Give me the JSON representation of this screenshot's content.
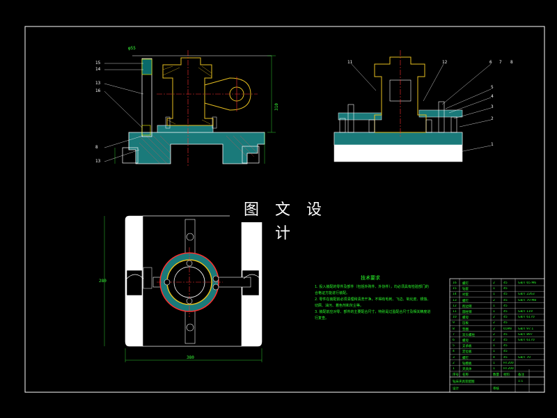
{
  "watermark": "图 文 设 计",
  "notes": {
    "title": "技术要求",
    "lines": [
      "1. 投入装配的零件及部件（包括外购件、外协件），均必须具有检验部门的",
      "合格证方能进行装配。",
      "2. 零件在装配前必须清理和清洗干净，不得有毛刺、飞边、氧化皮、锈蚀、",
      "切屑、油污、着色剂和灰尘等。",
      "3. 装配前应对零、部件的主要配合尺寸，特别是过盈配合尺寸及相关精度进",
      "行复查。"
    ]
  },
  "front_view_labels": [
    "15",
    "14",
    "13",
    "16",
    "8",
    "13"
  ],
  "side_view_labels": [
    "11",
    "12",
    "6",
    "7",
    "8",
    "5",
    "4",
    "3",
    "2",
    "1"
  ],
  "dimension_labels": {
    "top_left": "φ55",
    "height": "310",
    "plan_width": "380",
    "plan_height": "280"
  },
  "bom": {
    "rows": [
      [
        "16",
        "螺钉",
        "2",
        "45",
        "GB/T 65 M6"
      ],
      [
        "15",
        "钻套",
        "1",
        "45",
        ""
      ],
      [
        "14",
        "衬套",
        "1",
        "45",
        "GB/T 2263"
      ],
      [
        "13",
        "螺钉",
        "2",
        "45",
        "GB/T 70 M8"
      ],
      [
        "12",
        "削边销",
        "1",
        "45",
        ""
      ],
      [
        "11",
        "圆柱销",
        "1",
        "45",
        "GB/T 119"
      ],
      [
        "10",
        "螺母",
        "2",
        "45",
        "GB/T 6170"
      ],
      [
        "9",
        "压板",
        "2",
        "45",
        ""
      ],
      [
        "8",
        "垫圈",
        "2",
        "65Mn",
        "GB/T 97.1"
      ],
      [
        "7",
        "双头螺柱",
        "2",
        "45",
        "GB/T 897"
      ],
      [
        "6",
        "螺母",
        "2",
        "45",
        "GB/T 6170"
      ],
      [
        "5",
        "支承板",
        "1",
        "45",
        ""
      ],
      [
        "4",
        "定位板",
        "1",
        "45",
        ""
      ],
      [
        "3",
        "螺钉",
        "4",
        "45",
        "GB/T 70"
      ],
      [
        "2",
        "钻模板",
        "1",
        "HT200",
        ""
      ],
      [
        "1",
        "夹具体",
        "1",
        "HT200",
        ""
      ],
      [
        "序号",
        "名称",
        "数量",
        "材料",
        "备注"
      ]
    ],
    "title": "钻床夹具装配图",
    "scale": "1:1",
    "designer": "设计",
    "checker": "审核"
  }
}
